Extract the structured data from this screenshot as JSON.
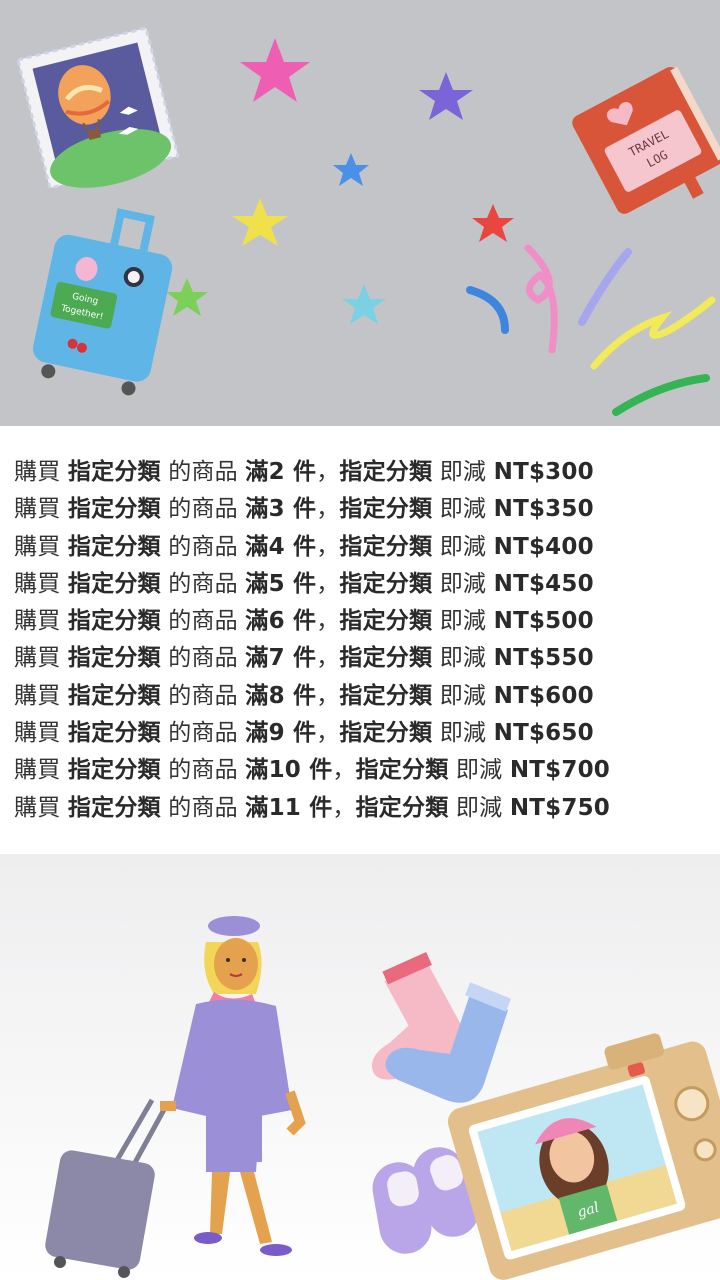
{
  "banner_top": {
    "travel_log_text": [
      "TRAVEL",
      "LOG"
    ],
    "suitcase_sticker_text": [
      "Going",
      "Together!"
    ]
  },
  "promo": {
    "lines": [
      {
        "p1": "購買",
        "b1": "指定分類",
        "p2": "的商品",
        "b2": "滿2 件",
        "p3": "，",
        "b3": "指定分類",
        "p4": "即減",
        "b4": "NT$300"
      },
      {
        "p1": "購買",
        "b1": "指定分類",
        "p2": "的商品",
        "b2": "滿3 件",
        "p3": "，",
        "b3": "指定分類",
        "p4": "即減",
        "b4": "NT$350"
      },
      {
        "p1": "購買",
        "b1": "指定分類",
        "p2": "的商品",
        "b2": "滿4 件",
        "p3": "，",
        "b3": "指定分類",
        "p4": "即減",
        "b4": "NT$400"
      },
      {
        "p1": "購買",
        "b1": "指定分類",
        "p2": "的商品",
        "b2": "滿5 件",
        "p3": "，",
        "b3": "指定分類",
        "p4": "即減",
        "b4": "NT$450"
      },
      {
        "p1": "購買",
        "b1": "指定分類",
        "p2": "的商品",
        "b2": "滿6 件",
        "p3": "，",
        "b3": "指定分類",
        "p4": "即減",
        "b4": "NT$500"
      },
      {
        "p1": "購買",
        "b1": "指定分類",
        "p2": "的商品",
        "b2": "滿7 件",
        "p3": "，",
        "b3": "指定分類",
        "p4": "即減",
        "b4": "NT$550"
      },
      {
        "p1": "購買",
        "b1": "指定分類",
        "p2": "的商品",
        "b2": "滿8 件",
        "p3": "，",
        "b3": "指定分類",
        "p4": "即減",
        "b4": "NT$600"
      },
      {
        "p1": "購買",
        "b1": "指定分類",
        "p2": "的商品",
        "b2": "滿9 件",
        "p3": "，",
        "b3": "指定分類",
        "p4": "即減",
        "b4": "NT$650"
      },
      {
        "p1": "購買",
        "b1": "指定分類",
        "p2": "的商品",
        "b2": "滿10 件",
        "p3": "，",
        "b3": "指定分類",
        "p4": "即減",
        "b4": "NT$700"
      },
      {
        "p1": "購買",
        "b1": "指定分類",
        "p2": "的商品",
        "b2": "滿11 件",
        "p3": "，",
        "b3": "指定分類",
        "p4": "即減",
        "b4": "NT$750"
      }
    ]
  },
  "banner_bottom": {
    "camera_screen_text": "gal"
  },
  "colors": {
    "top_bg": "#c3c4c8",
    "text": "#333333",
    "uniform_purple": "#9b8fd8",
    "suitcase_blue": "#5fb5e6",
    "travel_log_red": "#d9553a"
  }
}
